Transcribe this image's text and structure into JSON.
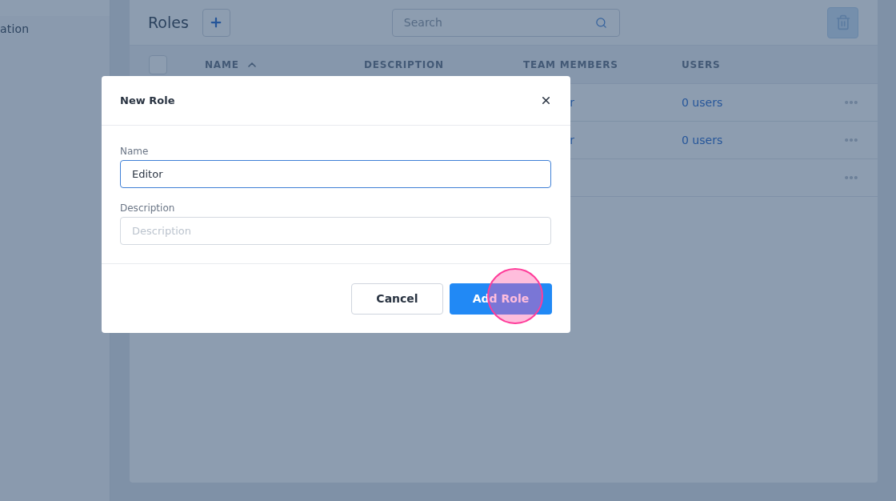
{
  "sidebar": {
    "items": [
      {
        "label": "ation"
      }
    ]
  },
  "page": {
    "title": "Roles",
    "search": {
      "placeholder": "Search"
    },
    "table": {
      "select_all": {
        "checked": false
      },
      "columns": [
        {
          "label": "NAME",
          "sorted_ascending": true
        },
        {
          "label": "DESCRIPTION"
        },
        {
          "label": "TEAM MEMBERS"
        },
        {
          "label": "USERS"
        }
      ],
      "rows": [
        {
          "team_members": "r",
          "users": "0 users"
        },
        {
          "team_members": "r",
          "users": "0 users"
        },
        {}
      ]
    }
  },
  "dialog": {
    "title": "New Role",
    "fields": [
      {
        "label": "Name",
        "value": "Editor",
        "focused": true
      },
      {
        "label": "Description",
        "placeholder": "Description",
        "focused": false
      }
    ],
    "buttons": [
      {
        "label": "Cancel",
        "kind": "secondary"
      },
      {
        "label": "Add Role",
        "kind": "primary"
      }
    ]
  }
}
